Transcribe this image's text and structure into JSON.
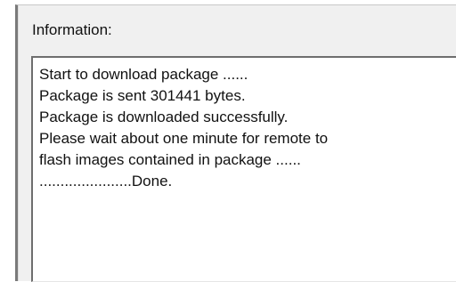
{
  "information_group": {
    "label": "Information:"
  },
  "log": {
    "lines": [
      "Start to download package ......",
      "Package is sent 301441 bytes.",
      "Package is downloaded successfully.",
      "Please wait about one minute for remote to",
      "flash images contained in package ......",
      "......................Done."
    ]
  }
}
